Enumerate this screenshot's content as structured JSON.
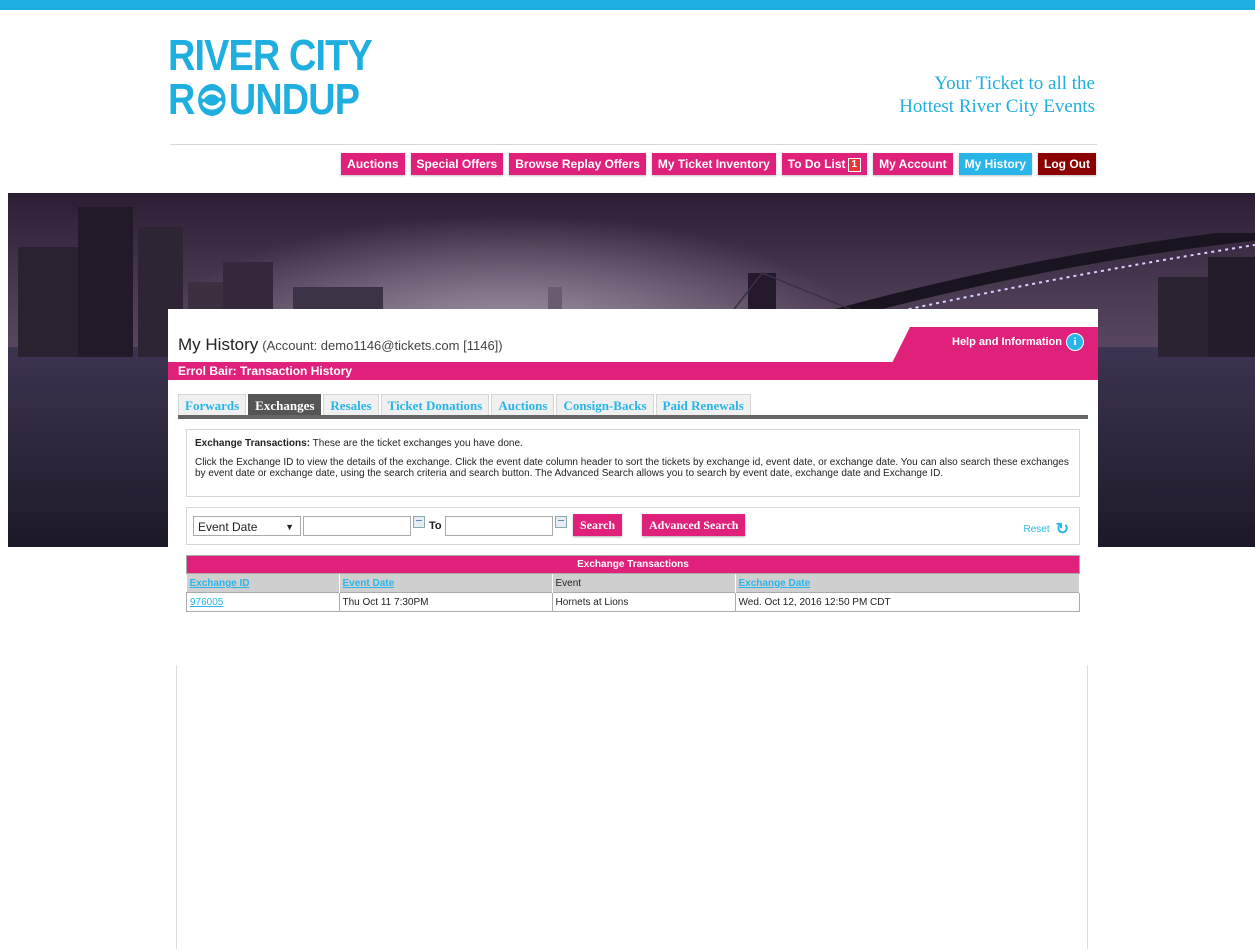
{
  "brand": {
    "logo_line1": "RIVER CITY",
    "logo_line2_pre": "R",
    "logo_line2_post": "UNDUP",
    "tagline_line1": "Your Ticket to all the",
    "tagline_line2": "Hottest River City Events",
    "accent": "#1eaee0",
    "pink": "#e0217c"
  },
  "nav": {
    "items": [
      {
        "label": "Auctions"
      },
      {
        "label": "Special Offers"
      },
      {
        "label": "Browse Replay Offers"
      },
      {
        "label": "My Ticket Inventory"
      },
      {
        "label": "To Do List",
        "badge": "1"
      },
      {
        "label": "My Account"
      },
      {
        "label": "My History",
        "active": true
      },
      {
        "label": "Log Out"
      }
    ]
  },
  "page": {
    "title": "My History",
    "account": "(Account: demo1146@tickets.com [1146])",
    "help_label": "Help and Information",
    "help_icon": "info-icon",
    "subheading": "Errol Bair: Transaction History"
  },
  "tabs": [
    {
      "label": "Forwards"
    },
    {
      "label": "Exchanges",
      "active": true
    },
    {
      "label": "Resales"
    },
    {
      "label": "Ticket Donations"
    },
    {
      "label": "Auctions"
    },
    {
      "label": "Consign-Backs"
    },
    {
      "label": "Paid Renewals"
    }
  ],
  "info": {
    "heading": "Exchange Transactions:",
    "heading_rest": " These are the ticket exchanges you have done.",
    "body": "Click the Exchange ID to view the details of the exchange. Click the event date column header to sort the tickets by exchange id, event date, or exchange date. You can also search these exchanges by event date or exchange date, using the search criteria and search button. The Advanced Search allows you to search by event date, exchange date and Exchange ID."
  },
  "search": {
    "select_value": "Event Date",
    "to_label": "To",
    "search_button": "Search",
    "advanced_button": "Advanced Search",
    "reset_label": "Reset",
    "reset_icon": "refresh-icon",
    "calendar_icon": "calendar-icon"
  },
  "table": {
    "caption": "Exchange Transactions",
    "headers": [
      "Exchange ID",
      "Event Date",
      "Event",
      "Exchange Date"
    ],
    "rows": [
      [
        "976005",
        "Thu Oct 11 7:30PM",
        "Hornets at Lions",
        "Wed. Oct 12, 2016 12:50 PM CDT"
      ]
    ]
  }
}
